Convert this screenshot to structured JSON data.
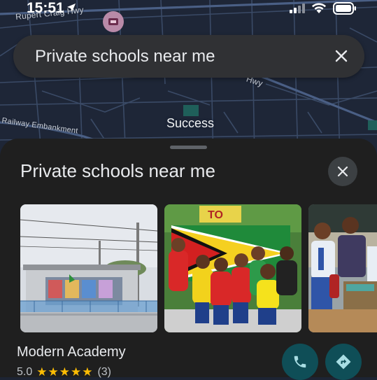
{
  "status_bar": {
    "time": "15:51"
  },
  "map": {
    "road_labels": [
      "Rupert Craig Hwy",
      "Hwy",
      "Railway Embankment"
    ],
    "place_label": "Success"
  },
  "search": {
    "query": "Private schools near me",
    "clear_icon": "close-icon"
  },
  "sheet": {
    "title": "Private schools near me",
    "close_icon": "close-icon",
    "result": {
      "name": "Modern Academy",
      "rating": "5.0",
      "stars": "★★★★★",
      "review_count": "(3)",
      "photo_sign_text": "TO"
    },
    "actions": [
      {
        "icon": "phone-icon",
        "label": "Call"
      },
      {
        "icon": "directions-icon",
        "label": "Directions"
      }
    ]
  },
  "colors": {
    "map_bg": "#1e2637",
    "sheet_bg": "#1f1f1f",
    "accent_button": "#0f4e57",
    "star": "#fbbc04"
  }
}
